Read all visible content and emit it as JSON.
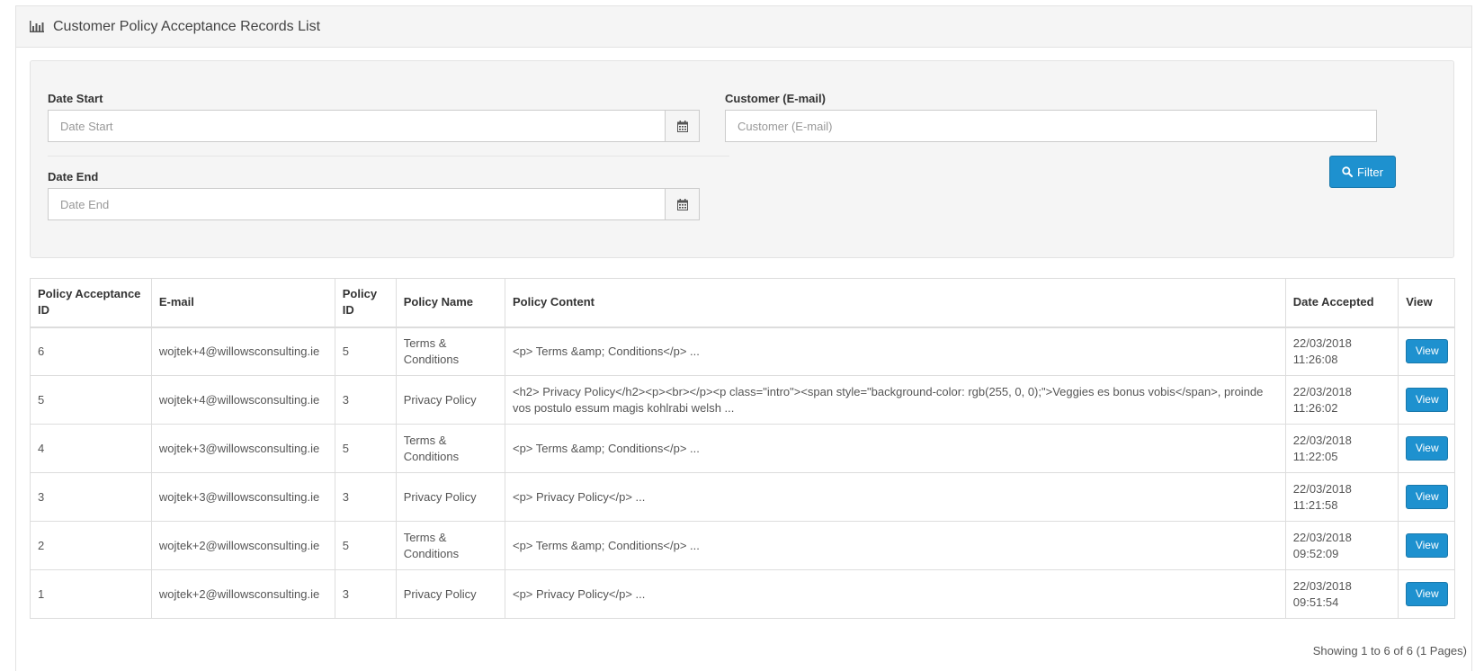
{
  "header": {
    "icon": "bar-chart-icon",
    "title": "Customer Policy Acceptance Records List"
  },
  "filters": {
    "date_start": {
      "label": "Date Start",
      "placeholder": "Date Start",
      "value": ""
    },
    "date_end": {
      "label": "Date End",
      "placeholder": "Date End",
      "value": ""
    },
    "customer": {
      "label": "Customer (E-mail)",
      "placeholder": "Customer (E-mail)",
      "value": ""
    },
    "filter_button": "Filter",
    "calendar_icon": "calendar-icon",
    "search_icon": "search-icon"
  },
  "table": {
    "columns": [
      "Policy Acceptance ID",
      "E-mail",
      "Policy ID",
      "Policy Name",
      "Policy Content",
      "Date Accepted",
      "View"
    ],
    "rows": [
      {
        "id": "6",
        "email": "wojtek+4@willowsconsulting.ie",
        "policy_id": "5",
        "policy_name": "Terms & Conditions",
        "content": "<p> Terms &amp; Conditions</p> ...",
        "date": "22/03/2018",
        "time": "11:26:08",
        "view": "View"
      },
      {
        "id": "5",
        "email": "wojtek+4@willowsconsulting.ie",
        "policy_id": "3",
        "policy_name": "Privacy Policy",
        "content": "<h2> Privacy Policy</h2><p><br></p><p class=\"intro\"><span style=\"background-color: rgb(255, 0, 0);\">Veggies es bonus vobis</span>, proinde vos postulo essum magis kohlrabi welsh ...",
        "date": "22/03/2018",
        "time": "11:26:02",
        "view": "View"
      },
      {
        "id": "4",
        "email": "wojtek+3@willowsconsulting.ie",
        "policy_id": "5",
        "policy_name": "Terms & Conditions",
        "content": "<p> Terms &amp; Conditions</p> ...",
        "date": "22/03/2018",
        "time": "11:22:05",
        "view": "View"
      },
      {
        "id": "3",
        "email": "wojtek+3@willowsconsulting.ie",
        "policy_id": "3",
        "policy_name": "Privacy Policy",
        "content": "<p> Privacy Policy</p> ...",
        "date": "22/03/2018",
        "time": "11:21:58",
        "view": "View"
      },
      {
        "id": "2",
        "email": "wojtek+2@willowsconsulting.ie",
        "policy_id": "5",
        "policy_name": "Terms & Conditions",
        "content": "<p> Terms &amp; Conditions</p> ...",
        "date": "22/03/2018",
        "time": "09:52:09",
        "view": "View"
      },
      {
        "id": "1",
        "email": "wojtek+2@willowsconsulting.ie",
        "policy_id": "3",
        "policy_name": "Privacy Policy",
        "content": "<p> Privacy Policy</p> ...",
        "date": "22/03/2018",
        "time": "09:51:54",
        "view": "View"
      }
    ]
  },
  "pagination": {
    "text": "Showing 1 to 6 of 6 (1 Pages)"
  },
  "colors": {
    "primary": "#1e91cf",
    "panel_bg": "#f5f5f5",
    "border": "#dddddd"
  }
}
